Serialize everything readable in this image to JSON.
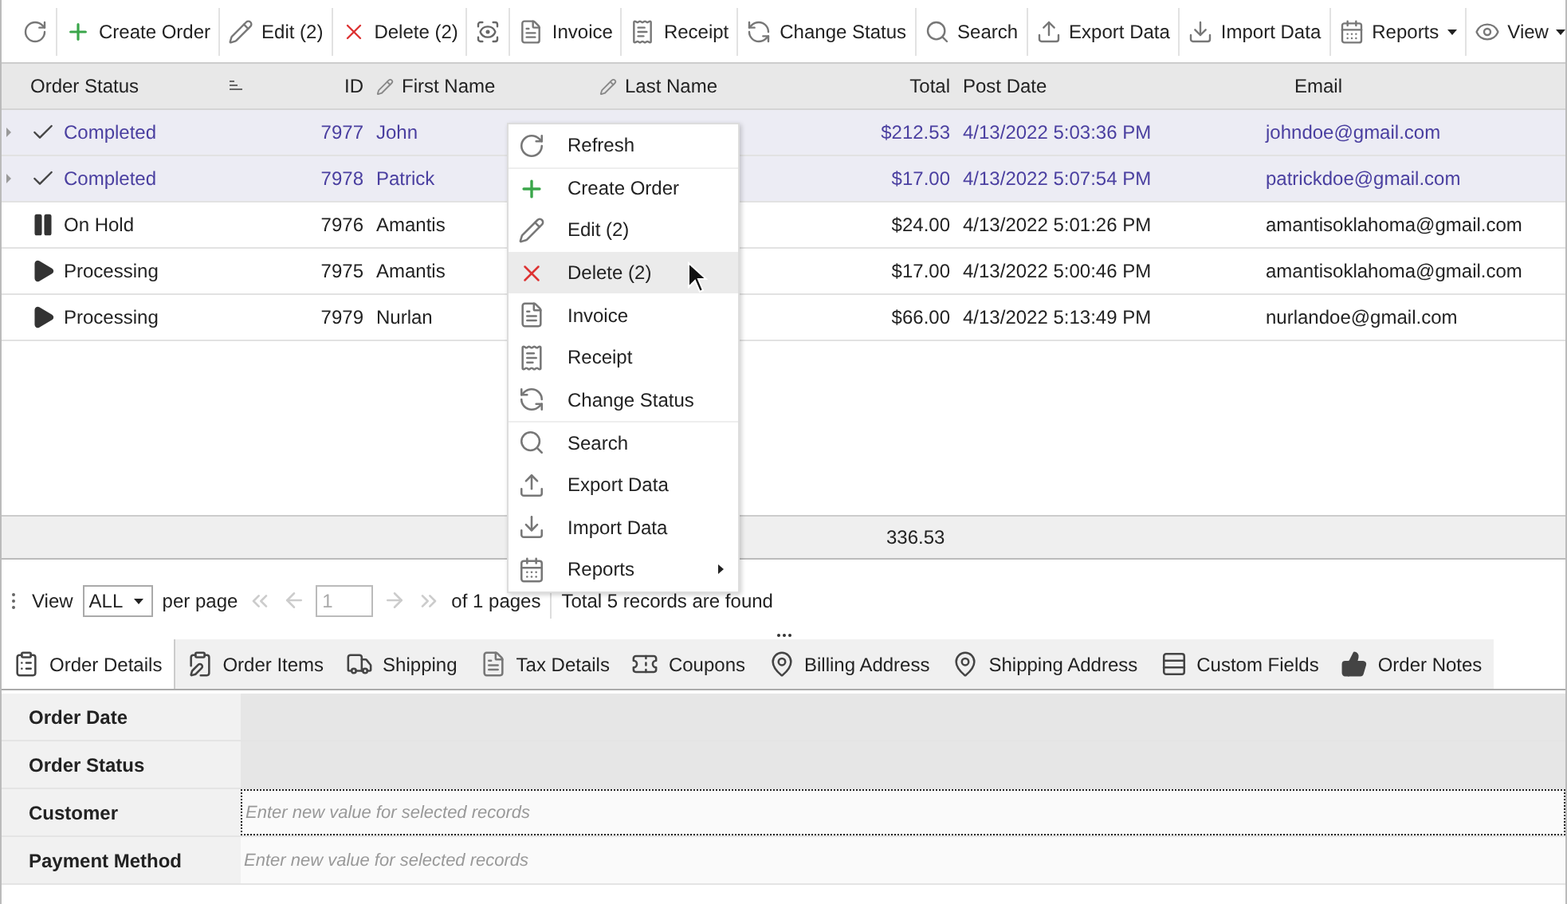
{
  "toolbar": [
    {
      "label": "Create Order"
    },
    {
      "label": "Edit (2)"
    },
    {
      "label": "Delete (2)"
    },
    {
      "label": "Invoice"
    },
    {
      "label": "Receipt"
    },
    {
      "label": "Change Status"
    },
    {
      "label": "Search"
    },
    {
      "label": "Export Data"
    },
    {
      "label": "Import Data"
    },
    {
      "label": "Reports",
      "dropdown": true
    },
    {
      "label": "View",
      "dropdown": true
    }
  ],
  "table": {
    "columns": [
      {
        "label": "Order Status"
      },
      {
        "label": "ID"
      },
      {
        "label": "First Name",
        "editable": true
      },
      {
        "label": "Last Name",
        "editable": true
      },
      {
        "label": "Total"
      },
      {
        "label": "Post Date"
      },
      {
        "label": "Email"
      }
    ],
    "rows": [
      {
        "kind": "completed",
        "status": "Completed",
        "id": "7977",
        "first": "John",
        "total": "$212.53",
        "date": "4/13/2022 5:03:36 PM",
        "email": "johndoe@gmail.com",
        "selected": true
      },
      {
        "kind": "completed",
        "status": "Completed",
        "id": "7978",
        "first": "Patrick",
        "total": "$17.00",
        "date": "4/13/2022 5:07:54 PM",
        "email": "patrickdoe@gmail.com",
        "selected": true
      },
      {
        "kind": "on_hold",
        "status": "On Hold",
        "id": "7976",
        "first": "Amantis",
        "total": "$24.00",
        "date": "4/13/2022 5:01:26 PM",
        "email": "amantisoklahoma@gmail.com",
        "selected": false
      },
      {
        "kind": "processing",
        "status": "Processing",
        "id": "7975",
        "first": "Amantis",
        "total": "$17.00",
        "date": "4/13/2022 5:00:46 PM",
        "email": "amantisoklahoma@gmail.com",
        "selected": false
      },
      {
        "kind": "processing",
        "status": "Processing",
        "id": "7979",
        "first": "Nurlan",
        "total": "$66.00",
        "date": "4/13/2022 5:13:49 PM",
        "email": "nurlandoe@gmail.com",
        "selected": false
      }
    ],
    "summary_total": "336.53"
  },
  "context_menu": [
    {
      "label": "Refresh",
      "selected": false
    },
    {
      "label": "Create Order",
      "selected": false
    },
    {
      "label": "Edit (2)",
      "selected": false
    },
    {
      "label": "Delete (2)",
      "selected": true
    },
    {
      "label": "Invoice",
      "selected": false
    },
    {
      "label": "Receipt",
      "selected": false
    },
    {
      "label": "Change Status",
      "selected": false
    },
    {
      "label": "Search",
      "selected": false
    },
    {
      "label": "Export Data",
      "selected": false
    },
    {
      "label": "Import Data",
      "selected": false
    },
    {
      "label": "Reports",
      "selected": false,
      "submenu": true
    }
  ],
  "pager": {
    "view_label": "View",
    "per_page_value": "ALL",
    "per_page_label": "per page",
    "page": "1",
    "pages_text": "of 1 pages",
    "records_text": "Total 5 records are found"
  },
  "tabs": [
    {
      "label": "Order Details",
      "selected": true
    },
    {
      "label": "Order Items",
      "selected": false
    },
    {
      "label": "Shipping",
      "selected": false
    },
    {
      "label": "Tax Details",
      "selected": false
    },
    {
      "label": "Coupons",
      "selected": false
    },
    {
      "label": "Billing Address",
      "selected": false
    },
    {
      "label": "Shipping Address",
      "selected": false
    },
    {
      "label": "Custom Fields",
      "selected": false
    },
    {
      "label": "Order Notes",
      "selected": false
    }
  ],
  "properties": [
    {
      "label": "Order Date",
      "disabled": true,
      "focused": false
    },
    {
      "label": "Order Status",
      "disabled": true,
      "focused": false
    },
    {
      "label": "Customer",
      "disabled": false,
      "focused": true,
      "placeholder": "Enter new value for selected records"
    },
    {
      "label": "Payment Method",
      "disabled": false,
      "focused": false,
      "placeholder": "Enter new value for selected records"
    }
  ]
}
